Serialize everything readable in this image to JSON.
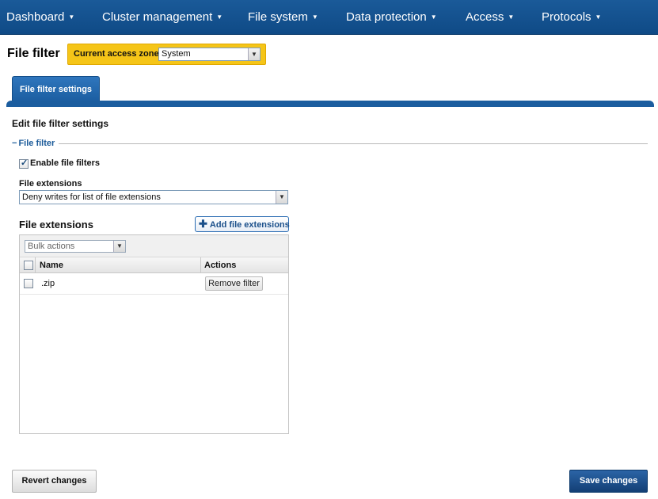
{
  "nav": {
    "items": [
      {
        "label": "Dashboard"
      },
      {
        "label": "Cluster management"
      },
      {
        "label": "File system"
      },
      {
        "label": "Data protection"
      },
      {
        "label": "Access"
      },
      {
        "label": "Protocols"
      }
    ],
    "caret": "▼"
  },
  "page": {
    "title": "File filter",
    "zone_label": "Current access zone:",
    "zone_value": "System"
  },
  "tabs": [
    {
      "label": "File filter settings"
    }
  ],
  "form": {
    "section_title": "Edit file filter settings",
    "legend_dash": "−",
    "legend": "File filter",
    "enable_label": "Enable file filters",
    "enable_checked": true,
    "extensions_label": "File extensions",
    "extensions_value": "Deny writes for list of file extensions"
  },
  "list": {
    "title": "File extensions",
    "add_label": "Add file extensions",
    "bulk_placeholder": "Bulk actions",
    "columns": [
      "Name",
      "Actions"
    ],
    "rows": [
      {
        "name": ".zip",
        "action": "Remove filter"
      }
    ]
  },
  "footer": {
    "revert_label": "Revert changes",
    "save_label": "Save changes"
  },
  "colors": {
    "nav_bg": "#1a5a99",
    "zone_bg": "#f5c518",
    "accent": "#1b5d9f",
    "save_bg": "#1e4f8c"
  },
  "icons": {
    "dropdown": "chevron-down-icon",
    "add": "plus-icon",
    "check": "check-icon"
  }
}
